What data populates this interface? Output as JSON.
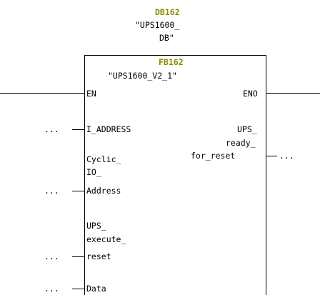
{
  "db_block": {
    "number": "DB162",
    "name_line1": "\"UPS1600_",
    "name_line2": "DB\""
  },
  "fb_block": {
    "number": "FB162",
    "name": "\"UPS1600_V2_1\""
  },
  "pins": {
    "en": "EN",
    "eno": "ENO",
    "i_address": "I_ADDRESS",
    "cyclic_l1": "Cyclic_",
    "cyclic_l2": "IO_",
    "cyclic_l3": "Address",
    "ups_exec_l1": "UPS_",
    "ups_exec_l2": "execute_",
    "ups_exec_l3": "reset",
    "data": "Data",
    "ups_ready_l1": "UPS_",
    "ups_ready_l2": "ready_",
    "ups_ready_l3": "for_reset"
  },
  "placeholders": {
    "ellipsis": "..."
  },
  "colors": {
    "block_number": "#8b8b00",
    "lines": "#000000"
  }
}
